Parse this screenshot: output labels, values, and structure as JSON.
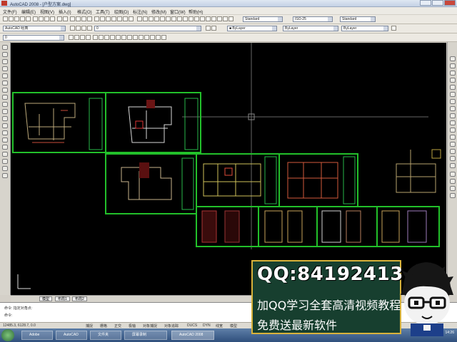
{
  "window": {
    "title": "AutoCAD 2008 - [户型方案.dwg]"
  },
  "menu": [
    "文件(F)",
    "编辑(E)",
    "视图(V)",
    "插入(I)",
    "格式(O)",
    "工具(T)",
    "绘图(D)",
    "标注(N)",
    "修改(M)",
    "窗口(W)",
    "帮助(H)"
  ],
  "toolbar": {
    "workspace_combo": "AutoCAD 经典",
    "layer_combo": "0",
    "text_style_combo": "Standard",
    "dim_style_combo": "ISO-25",
    "table_style_combo": "Standard",
    "color_combo": "■ ByLayer",
    "linetype_combo": "ByLayer",
    "lineweight_combo": "ByLayer",
    "layer_state_combo": "0"
  },
  "layout_tabs": [
    "模型",
    "布局1",
    "布局2"
  ],
  "command_line": {
    "line1": "命令: 指定对角点:",
    "line2": "命令:"
  },
  "status_bar": {
    "coords": "12485.3, 6128.7, 0.0",
    "items": [
      "捕捉",
      "栅格",
      "正交",
      "极轴",
      "对象捕捉",
      "对象追踪",
      "DUCS",
      "DYN",
      "线宽",
      "模型"
    ]
  },
  "taskbar": {
    "items": [
      "Adobe",
      "AutoCAD",
      "文件夹",
      "屏幕录制",
      "AutoCAD 2008"
    ],
    "clock": "14:26"
  },
  "promo": {
    "qq": "QQ:84192413",
    "line1": "加QQ学习全套高清视频教程",
    "line2": "免费送最新软件"
  },
  "colors": {
    "canvas": "#000000",
    "sheet_border": "#22c02a",
    "promo_bg": "#173f2f",
    "promo_border": "#d9b23a"
  }
}
